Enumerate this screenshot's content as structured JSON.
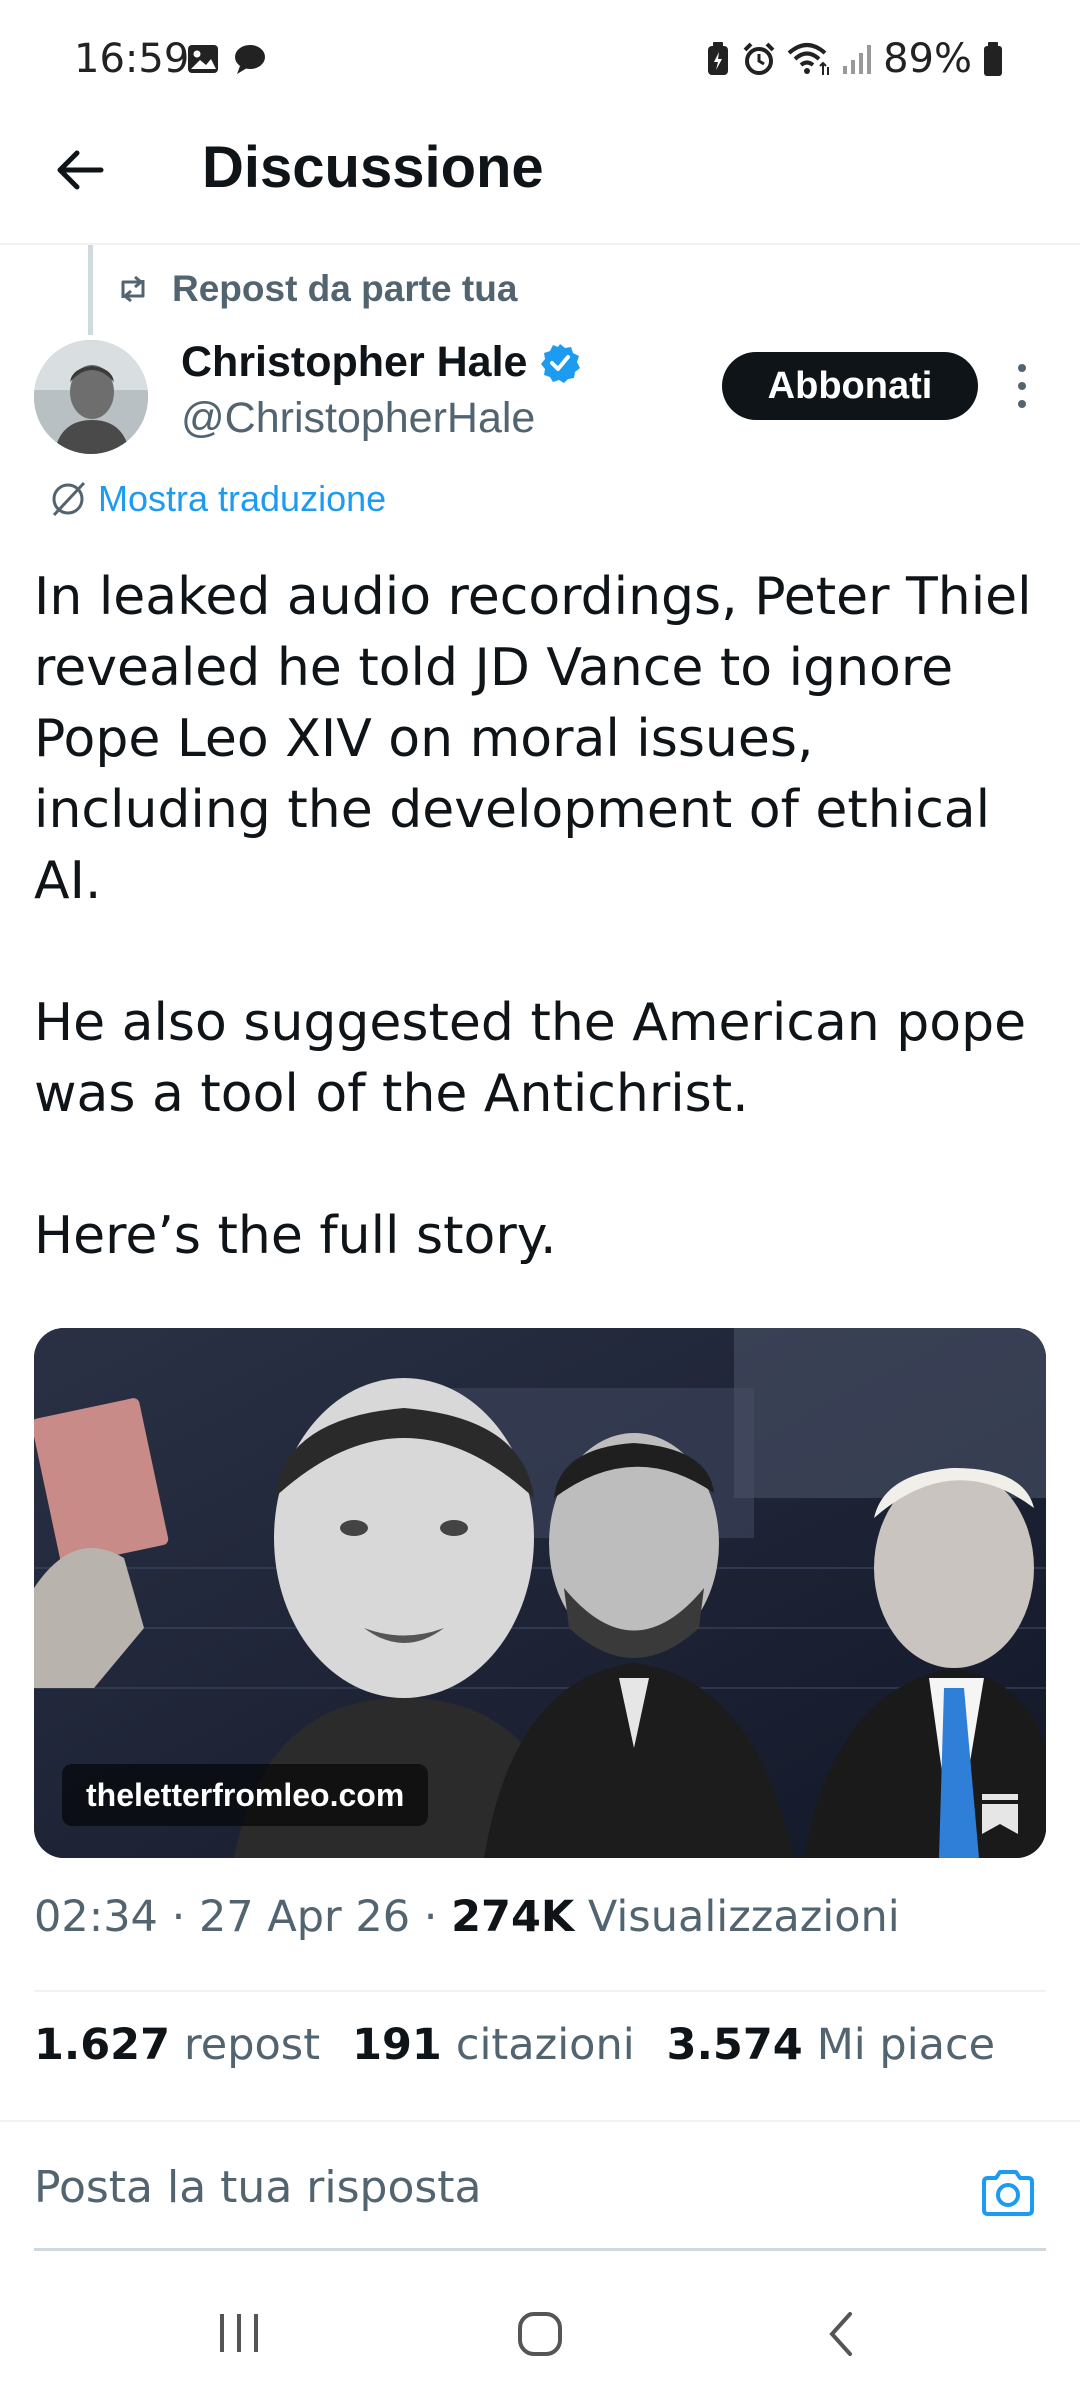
{
  "status_bar": {
    "time": "16:59",
    "battery": "89%",
    "icons_left": [
      "gallery-icon",
      "chat-bubble-icon"
    ],
    "icons_right": [
      "battery-saver-icon",
      "alarm-icon",
      "wifi-icon",
      "signal-icon",
      "battery-icon"
    ]
  },
  "header": {
    "title": "Discussione"
  },
  "repost": {
    "label": "Repost da parte tua"
  },
  "author": {
    "name": "Christopher Hale",
    "handle": "@ChristopherHale",
    "verified": true,
    "subscribe_label": "Abbonati"
  },
  "translate": {
    "label": "Mostra traduzione"
  },
  "tweet": {
    "paragraphs": [
      "In leaked audio recordings, Peter Thiel revealed he told JD Vance to ignore Pope Leo XIV on moral issues, including the development of ethical AI.",
      "He also suggested the American pope was a tool of the Antichrist.",
      "Here’s the full story."
    ],
    "media_domain": "theletterfromleo.com"
  },
  "meta": {
    "time": "02:34",
    "date": "27 Apr 26",
    "views_count": "274K",
    "views_label": "Visualizzazioni"
  },
  "stats": {
    "reposts_count": "1.627",
    "reposts_label": "repost",
    "quotes_count": "191",
    "quotes_label": "citazioni",
    "likes_count": "3.574",
    "likes_label": "Mi piace"
  },
  "reply": {
    "placeholder": "Posta la tua risposta"
  },
  "colors": {
    "accent": "#1d9bf0",
    "text": "#0f1419",
    "secondary": "#536471"
  }
}
